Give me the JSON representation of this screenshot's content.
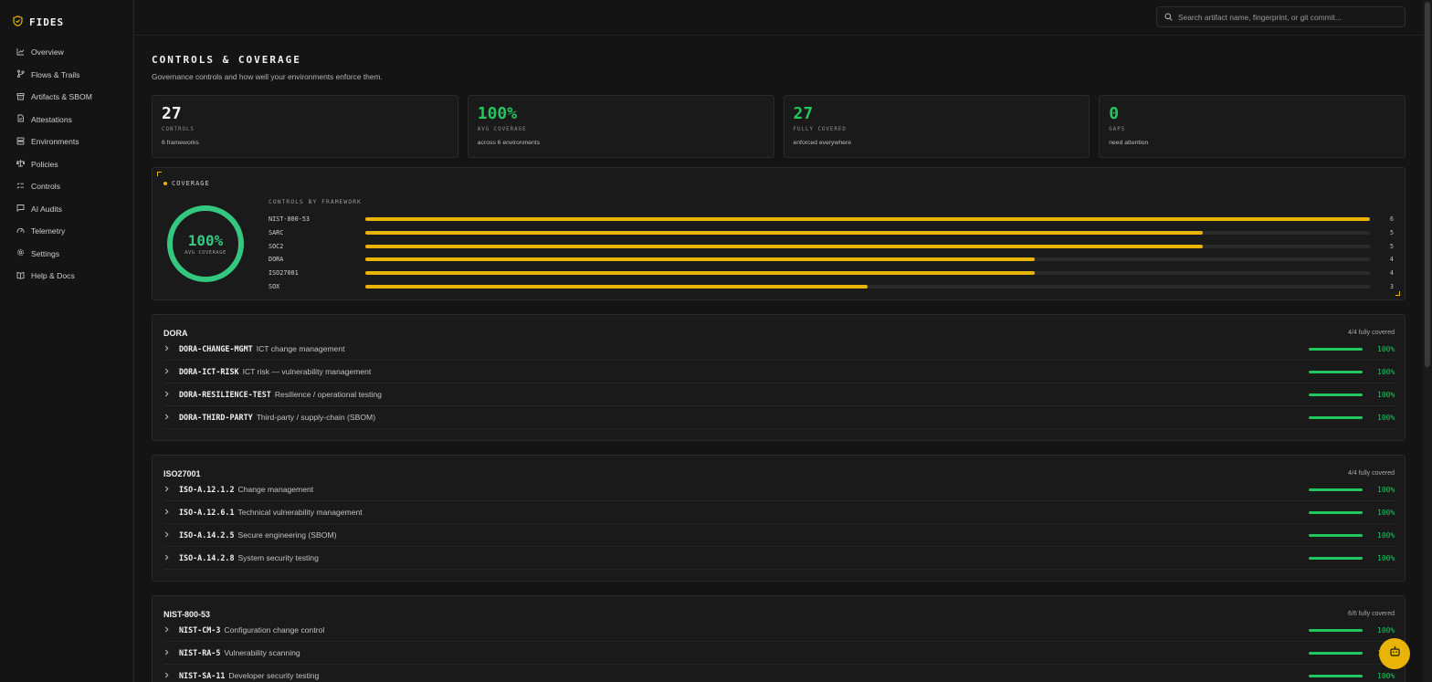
{
  "brand": {
    "name": "FIDES"
  },
  "sidebar": {
    "items": [
      {
        "label": "Overview",
        "icon": "chart-line-icon"
      },
      {
        "label": "Flows & Trails",
        "icon": "git-branch-icon"
      },
      {
        "label": "Artifacts & SBOM",
        "icon": "archive-icon"
      },
      {
        "label": "Attestations",
        "icon": "file-check-icon"
      },
      {
        "label": "Environments",
        "icon": "server-icon"
      },
      {
        "label": "Policies",
        "icon": "scale-icon"
      },
      {
        "label": "Controls",
        "icon": "list-checks-icon"
      },
      {
        "label": "AI Audits",
        "icon": "message-icon"
      },
      {
        "label": "Telemetry",
        "icon": "gauge-icon"
      },
      {
        "label": "Settings",
        "icon": "gear-icon"
      },
      {
        "label": "Help & Docs",
        "icon": "book-icon"
      }
    ]
  },
  "search": {
    "placeholder": "Search artifact name, fingerprint, or git commit..."
  },
  "page": {
    "title": "CONTROLS & COVERAGE",
    "subtitle": "Governance controls and how well your environments enforce them."
  },
  "stats": [
    {
      "value": "27",
      "label": "CONTROLS",
      "note": "6 frameworks",
      "accent": false
    },
    {
      "value": "100%",
      "label": "AVG COVERAGE",
      "note": "across 6 environments",
      "accent": true
    },
    {
      "value": "27",
      "label": "FULLY COVERED",
      "note": "enforced everywhere",
      "accent": true
    },
    {
      "value": "0",
      "label": "GAPS",
      "note": "need attention",
      "accent": true
    }
  ],
  "coverage": {
    "title": "COVERAGE",
    "ring_value": "100%",
    "ring_label": "AVG COVERAGE",
    "frameworks_heading": "CONTROLS BY FRAMEWORK",
    "max": 6,
    "frameworks": [
      {
        "name": "NIST-800-53",
        "count": 6
      },
      {
        "name": "SARC",
        "count": 5
      },
      {
        "name": "SOC2",
        "count": 5
      },
      {
        "name": "DORA",
        "count": 4
      },
      {
        "name": "ISO27001",
        "count": 4
      },
      {
        "name": "SOX",
        "count": 3
      }
    ]
  },
  "groups": [
    {
      "name": "DORA",
      "status": "4/4 fully covered",
      "controls": [
        {
          "id": "DORA-CHANGE-MGMT",
          "desc": "ICT change management",
          "pct": "100%"
        },
        {
          "id": "DORA-ICT-RISK",
          "desc": "ICT risk — vulnerability management",
          "pct": "100%"
        },
        {
          "id": "DORA-RESILIENCE-TEST",
          "desc": "Resilience / operational testing",
          "pct": "100%"
        },
        {
          "id": "DORA-THIRD-PARTY",
          "desc": "Third-party / supply-chain (SBOM)",
          "pct": "100%"
        }
      ]
    },
    {
      "name": "ISO27001",
      "status": "4/4 fully covered",
      "controls": [
        {
          "id": "ISO-A.12.1.2",
          "desc": "Change management",
          "pct": "100%"
        },
        {
          "id": "ISO-A.12.6.1",
          "desc": "Technical vulnerability management",
          "pct": "100%"
        },
        {
          "id": "ISO-A.14.2.5",
          "desc": "Secure engineering (SBOM)",
          "pct": "100%"
        },
        {
          "id": "ISO-A.14.2.8",
          "desc": "System security testing",
          "pct": "100%"
        }
      ]
    },
    {
      "name": "NIST-800-53",
      "status": "6/6 fully covered",
      "controls": [
        {
          "id": "NIST-CM-3",
          "desc": "Configuration change control",
          "pct": "100%"
        },
        {
          "id": "NIST-RA-5",
          "desc": "Vulnerability scanning",
          "pct": "100%"
        },
        {
          "id": "NIST-SA-11",
          "desc": "Developer security testing",
          "pct": "100%"
        }
      ]
    }
  ],
  "colors": {
    "accent": "#eab308",
    "success": "#22c55e",
    "ring": "#34c77f",
    "background": "#141414"
  }
}
